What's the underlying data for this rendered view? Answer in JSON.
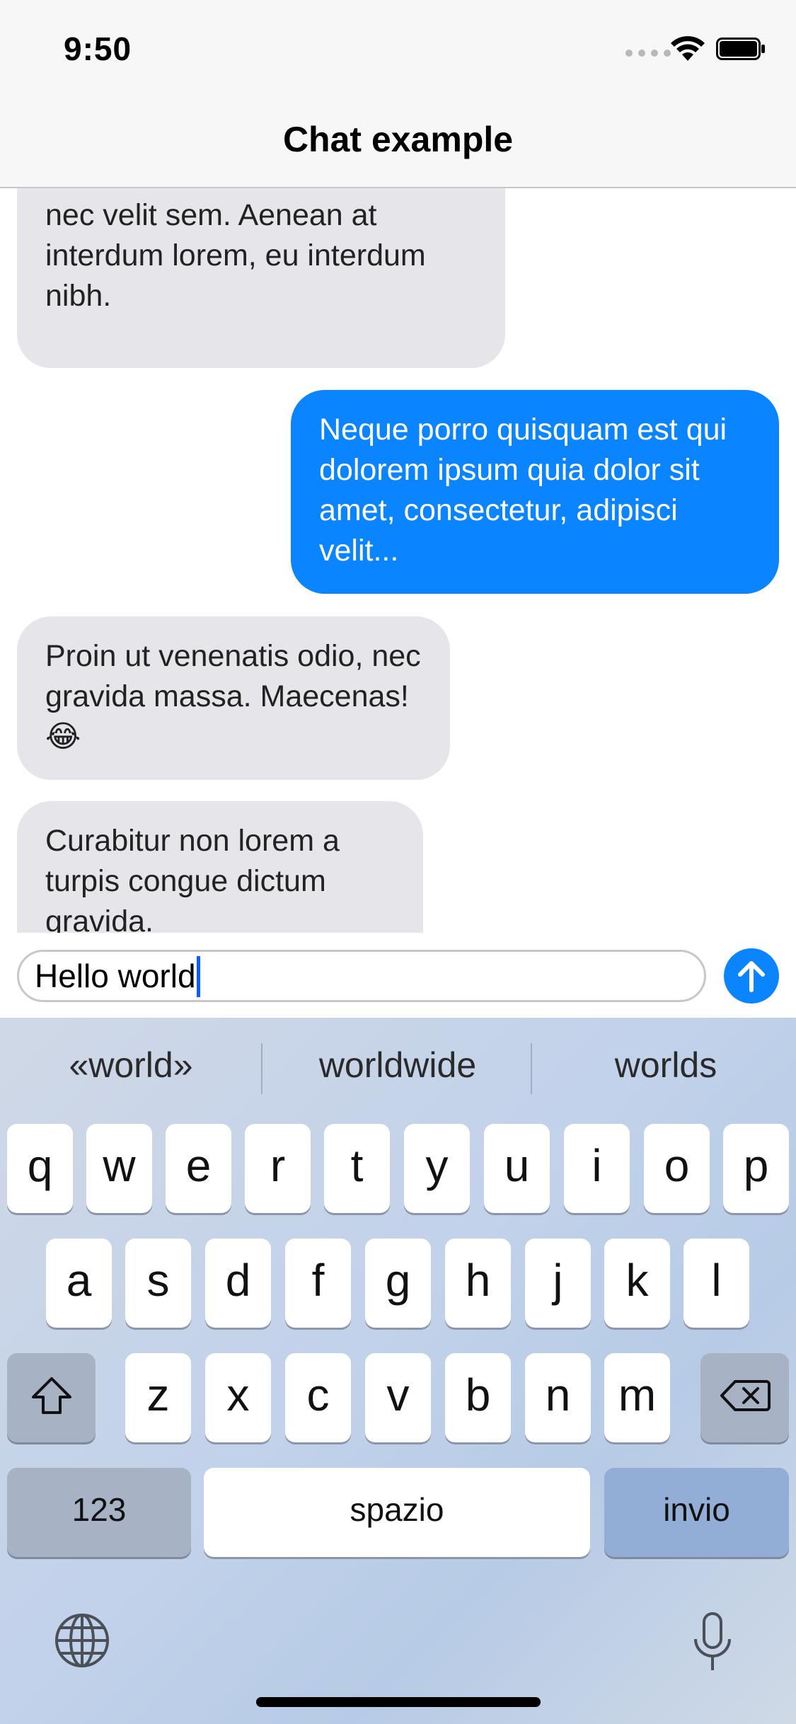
{
  "status_bar": {
    "time": "9:50"
  },
  "nav": {
    "title": "Chat example"
  },
  "messages": [
    {
      "side": "incoming",
      "text": "nec velit sem. Aenean at interdum lorem, eu interdum nibh."
    },
    {
      "side": "outgoing",
      "text": "Neque porro quisquam est qui dolorem ipsum quia dolor sit amet, consectetur, adipisci velit..."
    },
    {
      "side": "incoming",
      "text": "Proin ut venenatis odio, nec gravida massa. Maecenas! 😂"
    },
    {
      "side": "incoming",
      "text": "Curabitur non lorem a turpis congue dictum gravida."
    }
  ],
  "composer": {
    "value": "Hello world"
  },
  "keyboard": {
    "suggestions": [
      "«world»",
      "worldwide",
      "worlds"
    ],
    "row1": [
      "q",
      "w",
      "e",
      "r",
      "t",
      "y",
      "u",
      "i",
      "o",
      "p"
    ],
    "row2": [
      "a",
      "s",
      "d",
      "f",
      "g",
      "h",
      "j",
      "k",
      "l"
    ],
    "row3": [
      "z",
      "x",
      "c",
      "v",
      "b",
      "n",
      "m"
    ],
    "numbers_key": "123",
    "space_key": "spazio",
    "return_key": "invio"
  },
  "colors": {
    "accent": "#0a84ff",
    "incoming_bubble": "#e5e5ea"
  }
}
